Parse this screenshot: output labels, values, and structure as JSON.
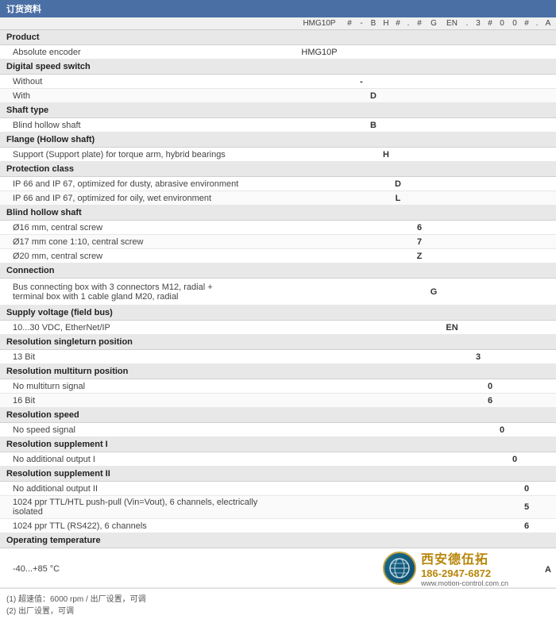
{
  "header": {
    "title": "订货资料"
  },
  "columns": {
    "model": "HMG10P",
    "codes": [
      "#",
      "-",
      "B",
      "H",
      "#",
      ".",
      "#",
      "G",
      "EN",
      ".",
      "3",
      "#",
      "0",
      "0",
      "#",
      ".",
      "A"
    ]
  },
  "sections": [
    {
      "id": "product",
      "title": "Product",
      "rows": [
        {
          "label": "Absolute encoder",
          "code": "HMG10P",
          "col": "model"
        }
      ]
    },
    {
      "id": "digital-speed-switch",
      "title": "Digital speed switch",
      "rows": [
        {
          "label": "Without",
          "code": "-",
          "col": 1
        },
        {
          "label": "With",
          "code": "D",
          "col": 3
        }
      ]
    },
    {
      "id": "shaft-type",
      "title": "Shaft type",
      "rows": [
        {
          "label": "Blind hollow shaft",
          "code": "B",
          "col": 2
        }
      ]
    },
    {
      "id": "flange",
      "title": "Flange (Hollow shaft)",
      "rows": [
        {
          "label": "Support (Support plate) for torque arm, hybrid bearings",
          "code": "H",
          "col": 3
        }
      ]
    },
    {
      "id": "protection",
      "title": "Protection class",
      "rows": [
        {
          "label": "IP 66 and IP 67, optimized for dusty, abrasive environment",
          "code": "D",
          "col": 5
        },
        {
          "label": "IP 66 and IP 67, optimized for oily, wet environment",
          "code": "L",
          "col": 5
        }
      ]
    },
    {
      "id": "blind-hollow-shaft",
      "title": "Blind hollow shaft",
      "rows": [
        {
          "label": "Ø16 mm, central screw",
          "code": "6",
          "col": 7
        },
        {
          "label": "Ø17 mm cone 1:10, central screw",
          "code": "7",
          "col": 7
        },
        {
          "label": "Ø20 mm, central screw",
          "code": "Z",
          "col": 7
        }
      ]
    },
    {
      "id": "connection",
      "title": "Connection",
      "rows": [
        {
          "label": "Bus connecting box with 3 connectors M12, radial +\nterminal box with 1 cable gland M20, radial",
          "code": "G",
          "col": 9
        }
      ]
    },
    {
      "id": "supply-voltage",
      "title": "Supply voltage (field bus)",
      "rows": [
        {
          "label": "10...30 VDC, EtherNet/IP",
          "code": "EN",
          "col": 10
        }
      ]
    },
    {
      "id": "resolution-singleturn",
      "title": "Resolution singleturn position",
      "rows": [
        {
          "label": "13 Bit",
          "code": "3",
          "col": 12
        }
      ]
    },
    {
      "id": "resolution-multiturn",
      "title": "Resolution multiturn position",
      "rows": [
        {
          "label": "No multiturn signal",
          "code": "0",
          "col": 13
        },
        {
          "label": "16 Bit",
          "code": "6",
          "col": 13
        }
      ]
    },
    {
      "id": "resolution-speed",
      "title": "Resolution speed",
      "rows": [
        {
          "label": "No speed signal",
          "code": "0",
          "col": 14
        }
      ]
    },
    {
      "id": "resolution-supplement-1",
      "title": "Resolution supplement I",
      "rows": [
        {
          "label": "No additional output I",
          "code": "0",
          "col": 15
        }
      ]
    },
    {
      "id": "resolution-supplement-2",
      "title": "Resolution supplement II",
      "rows": [
        {
          "label": "No additional output II",
          "code": "0",
          "col": 16
        },
        {
          "label": "1024 ppr TTL/HTL push-pull (Vin=Vout), 6 channels, electrically isolated",
          "code": "5",
          "col": 16
        },
        {
          "label": "1024 ppr TTL (RS422), 6 channels",
          "code": "6",
          "col": 16
        }
      ]
    },
    {
      "id": "operating-temp",
      "title": "Operating temperature",
      "rows": [
        {
          "label": "-40...+85 °C",
          "code": "A",
          "col": 17
        }
      ]
    }
  ],
  "footer": {
    "notes": [
      "(1) 超速值：6000 rpm / 出厂设置，可调",
      "(2) 出厂设置，可调"
    ]
  },
  "watermark": {
    "company_cn": "西安德伍拓",
    "phone": "186-2947-6872",
    "url": "www.motion-control.com.cn"
  }
}
